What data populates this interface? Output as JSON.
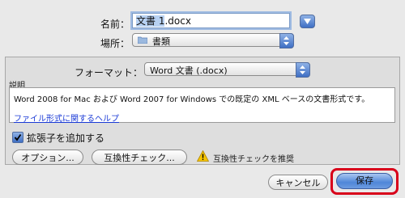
{
  "save_as": {
    "name_label": "名前：",
    "name_value": "文書 1",
    "name_ext": ".docx",
    "where_label": "場所：",
    "where_value": "書類"
  },
  "options": {
    "format_label": "フォーマット：",
    "format_value": "Word 文書 (.docx)",
    "description_title": "説明",
    "description_text": "Word 2008 for Mac および Word 2007 for Windows での既定の XML ベースの文書形式です。",
    "help_link": "ファイル形式に関するヘルプ",
    "append_ext_label": "拡張子を追加する",
    "append_ext_checked": true,
    "options_button": "オプション...",
    "compat_button": "互換性チェック...",
    "compat_warning": "互換性チェックを推奨"
  },
  "footer": {
    "cancel_button": "キャンセル",
    "save_button": "保存"
  },
  "colors": {
    "accent_blue": "#3f6fc4",
    "highlight_ring": "#d8001a",
    "link": "#1a3ad6"
  }
}
